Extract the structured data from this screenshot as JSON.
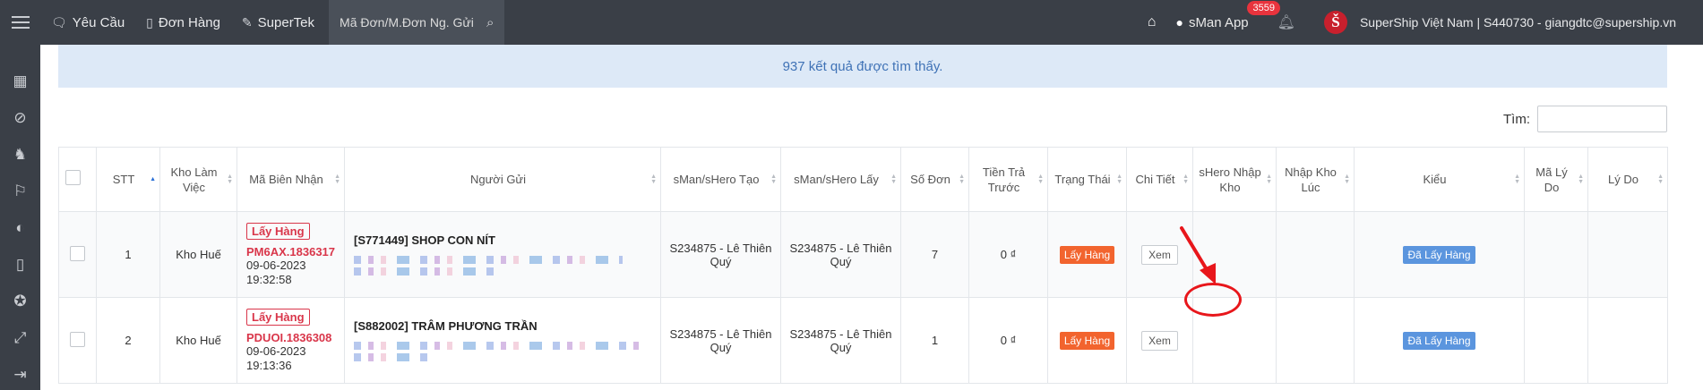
{
  "navbar": {
    "items": [
      {
        "icon": "chat-icon",
        "label": "Yêu Cầu"
      },
      {
        "icon": "book-icon",
        "label": "Đơn Hàng"
      },
      {
        "icon": "edit-icon",
        "label": "SuperTek"
      }
    ],
    "search_placeholder": "Mã Đơn/M.Đơn Ng. Gửi",
    "app_label": "sMan App",
    "notification_count": "3559",
    "account": "SuperShip Việt Nam | S440730 - giangdtc@supership.vn",
    "brand_letter": "Š"
  },
  "sidebar": {
    "icons": [
      "grid-icon",
      "compass-icon",
      "chess-knight-icon",
      "flag-icon",
      "palette-icon",
      "book-icon",
      "lightbulb-icon",
      "expand-icon",
      "sign-in-icon"
    ]
  },
  "results": {
    "summary": "937 kết quả được tìm thấy."
  },
  "table_search": {
    "label": "Tìm:",
    "value": ""
  },
  "table": {
    "columns": [
      "STT",
      "Kho Làm Việc",
      "Mã Biên Nhận",
      "Người Gửi",
      "sMan/sHero Tạo",
      "sMan/sHero Lấy",
      "Số Đơn",
      "Tiền Trả Trước",
      "Trạng Thái",
      "Chi Tiết",
      "sHero Nhập Kho",
      "Nhập Kho Lúc",
      "Kiểu",
      "Mã Lý Do",
      "Lý Do"
    ],
    "rows": [
      {
        "stt": "1",
        "warehouse": "Kho Huế",
        "tag": "Lấy Hàng",
        "code": "PM6AX.1836317",
        "date": "09-06-2023",
        "time": "19:32:58",
        "sender": "[S771449] SHOP CON NÍT",
        "created_by": "S234875 - Lê Thiên Quý",
        "picked_by": "S234875 - Lê Thiên Quý",
        "order_count": "7",
        "prepaid": "0 ₫",
        "status": "Lấy Hàng",
        "detail": "Xem",
        "type": "Đã Lấy Hàng"
      },
      {
        "stt": "2",
        "warehouse": "Kho Huế",
        "tag": "Lấy Hàng",
        "code": "PDUOI.1836308",
        "date": "09-06-2023",
        "time": "19:13:36",
        "sender": "[S882002] TRÂM PHƯƠNG TRẦN",
        "created_by": "S234875 - Lê Thiên Quý",
        "picked_by": "S234875 - Lê Thiên Quý",
        "order_count": "1",
        "prepaid": "0 ₫",
        "status": "Lấy Hàng",
        "detail": "Xem",
        "type": "Đã Lấy Hàng"
      }
    ]
  },
  "colors": {
    "topbar": "#3a3f47",
    "result_bar": "#dde9f7",
    "status_orange": "#f2642e",
    "status_blue": "#5b95de",
    "code_red": "#d9364a",
    "annotation_red": "#e8161b"
  }
}
